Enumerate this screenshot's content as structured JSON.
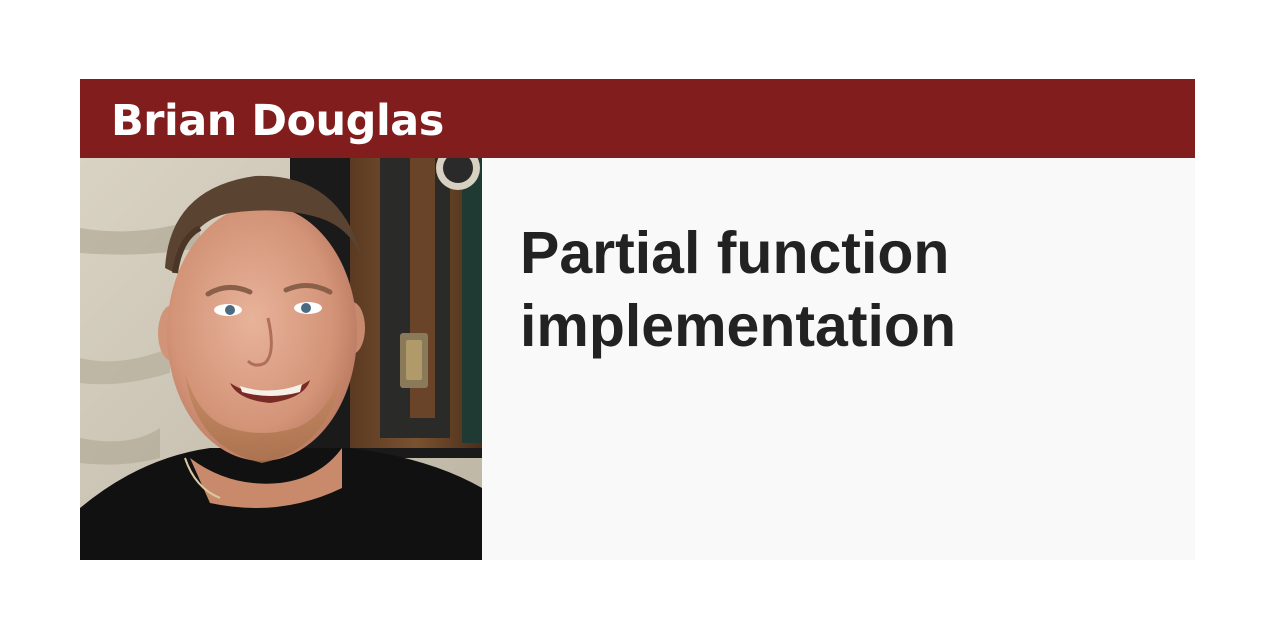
{
  "card": {
    "author_name": "Brian Douglas",
    "title": "Partial function implementation",
    "header_color": "#821d1d",
    "background_color": "#f9f9f9",
    "title_color": "#222222"
  },
  "photo": {
    "subject": "portrait-of-author"
  }
}
